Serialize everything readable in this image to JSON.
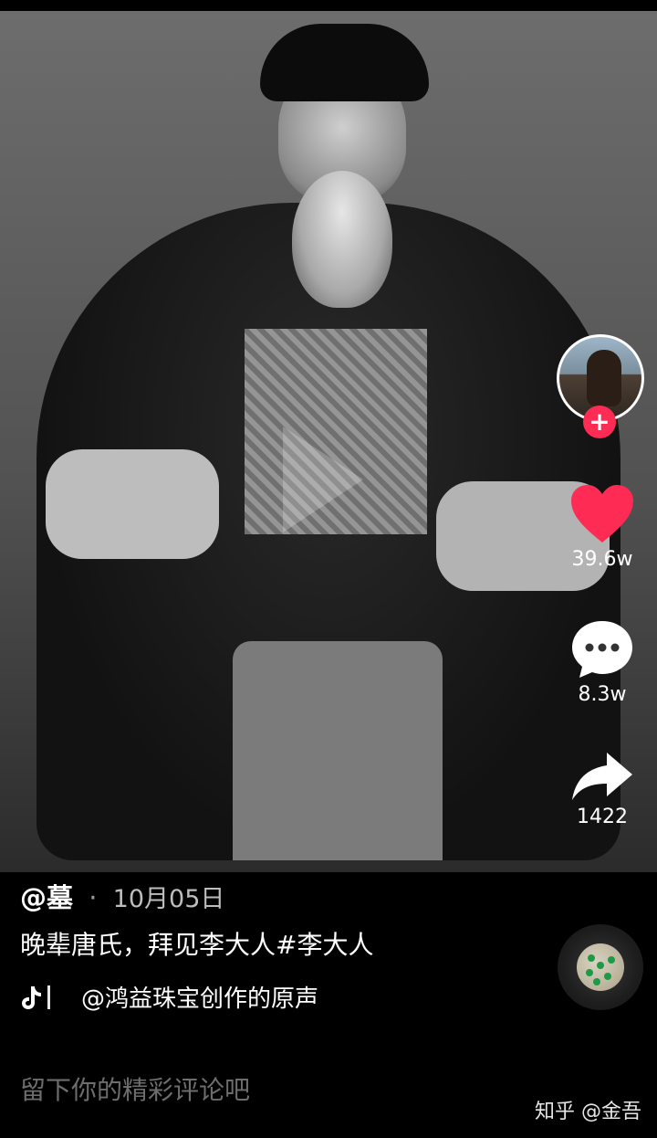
{
  "actions": {
    "likes": "39.6w",
    "comments": "8.3w",
    "shares": "1422",
    "like_color": "#fe2c55"
  },
  "author": {
    "name": "@墓",
    "separator": "·",
    "date": "10月05日"
  },
  "caption": "晚辈唐氏，拜见李大人#李大人",
  "music": {
    "title": "@鸿益珠宝创作的原声"
  },
  "follow": {
    "label": "+"
  },
  "comment_placeholder": "留下你的精彩评论吧",
  "watermark": "知乎 @金吾"
}
